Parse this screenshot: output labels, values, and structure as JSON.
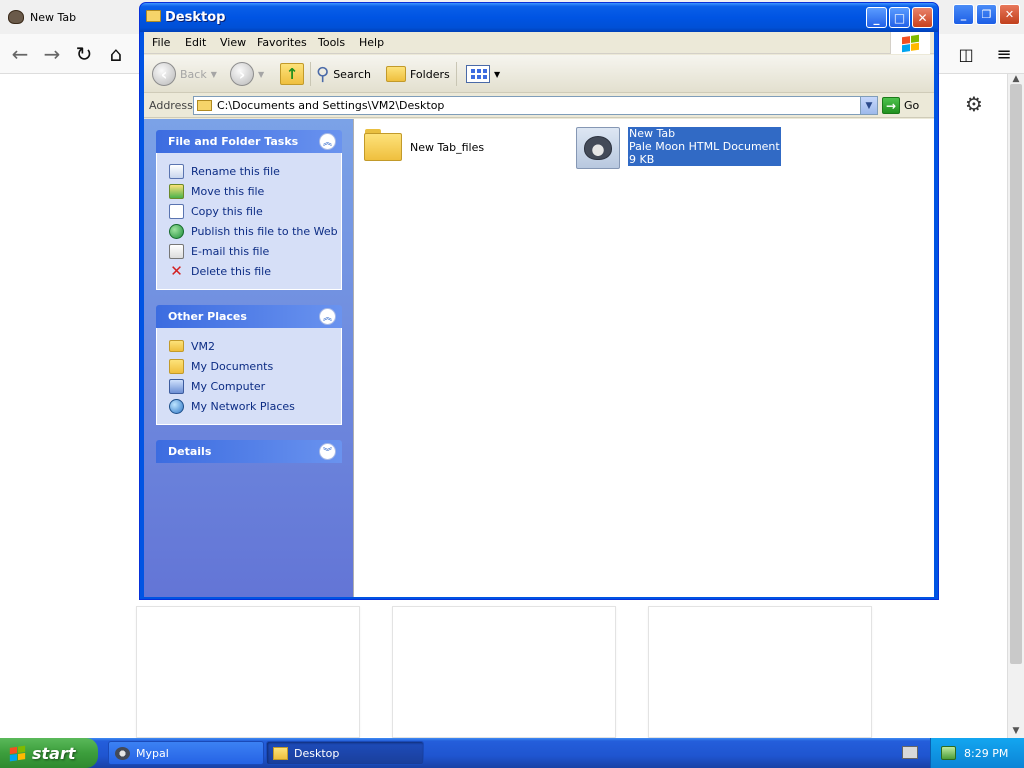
{
  "browser": {
    "tab_title": "New Tab"
  },
  "explorer": {
    "title": "Desktop",
    "menu": [
      "File",
      "Edit",
      "View",
      "Favorites",
      "Tools",
      "Help"
    ],
    "toolbar": {
      "back_label": "Back",
      "search_label": "Search",
      "folders_label": "Folders"
    },
    "address": {
      "label": "Address",
      "value": "C:\\Documents and Settings\\VM2\\Desktop",
      "go_label": "Go"
    },
    "panels": {
      "file_tasks": {
        "title": "File and Folder Tasks",
        "items": [
          "Rename this file",
          "Move this file",
          "Copy this file",
          "Publish this file to the Web",
          "E-mail this file",
          "Delete this file"
        ]
      },
      "other_places": {
        "title": "Other Places",
        "items": [
          "VM2",
          "My Documents",
          "My Computer",
          "My Network Places"
        ]
      },
      "details": {
        "title": "Details"
      }
    },
    "files": [
      {
        "name": "New Tab_files"
      },
      {
        "name": "New Tab",
        "type": "Pale Moon HTML Document",
        "size": "9 KB",
        "selected": true
      }
    ]
  },
  "taskbar": {
    "start_label": "start",
    "tasks": [
      {
        "label": "Mypal",
        "active": false
      },
      {
        "label": "Desktop",
        "active": true
      }
    ],
    "clock": "8:29 PM"
  },
  "colors": {
    "xp_blue": "#0054e3",
    "task_pane_top": "#7ba2e7",
    "selection": "#316ac5",
    "start_green": "#3c9e3c"
  }
}
